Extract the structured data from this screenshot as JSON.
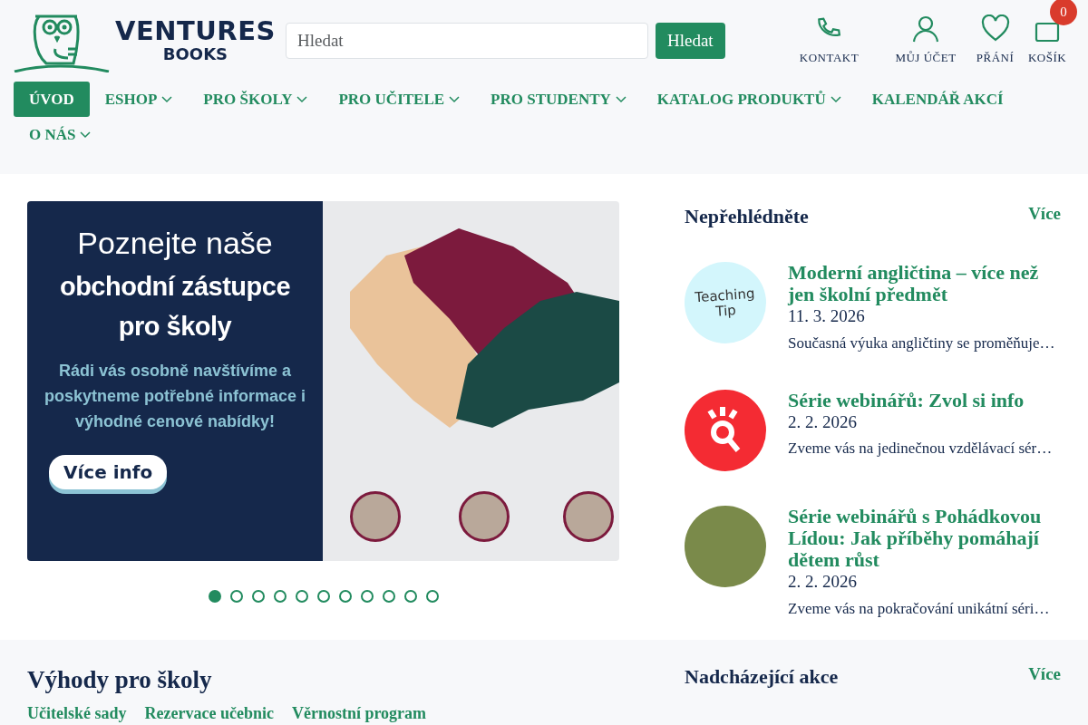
{
  "header": {
    "logo": {
      "line1": "VENTURES",
      "line2": "BOOKS"
    },
    "search": {
      "placeholder": "Hledat",
      "button": "Hledat"
    },
    "actions": [
      {
        "kind": "phone",
        "label": "KONTAKT"
      },
      {
        "kind": "user",
        "label": "MŮJ ÚČET"
      },
      {
        "kind": "heart",
        "label": "PŘÁNÍ"
      },
      {
        "kind": "cart",
        "label": "KOŠÍK",
        "badge": "0"
      }
    ]
  },
  "nav": [
    {
      "label": "ÚVOD",
      "selected": true,
      "dropdown": false
    },
    {
      "label": "ESHOP",
      "selected": false,
      "dropdown": true
    },
    {
      "label": "PRO ŠKOLY",
      "selected": false,
      "dropdown": true
    },
    {
      "label": "PRO UČITELE",
      "selected": false,
      "dropdown": true
    },
    {
      "label": "PRO STUDENTY",
      "selected": false,
      "dropdown": true
    },
    {
      "label": "KATALOG PRODUKTŮ",
      "selected": false,
      "dropdown": true
    },
    {
      "label": "KALENDÁŘ AKCÍ",
      "selected": false,
      "dropdown": false
    },
    {
      "label": "O NÁS",
      "selected": false,
      "dropdown": true
    }
  ],
  "banner": {
    "heading_light": "Poznejte naše",
    "heading_bold": "obchodní zástupce pro školy",
    "text": "Rádi vás osobně navštívíme a poskytneme potřebné informace i **výhodné cenové nabídky!**",
    "button": "Více info"
  },
  "carousel_dots": [
    {
      "selected": true
    },
    {
      "selected": false
    },
    {
      "selected": false
    },
    {
      "selected": false
    },
    {
      "selected": false
    },
    {
      "selected": false
    },
    {
      "selected": false
    },
    {
      "selected": false
    },
    {
      "selected": false
    },
    {
      "selected": false
    },
    {
      "selected": false
    }
  ],
  "highlights": {
    "title": "Nepřehlédněte",
    "more": "Více",
    "items": [
      {
        "kind": "teaching-tip",
        "thumb_text": "Teaching Tip",
        "title": "Moderní angličtina – více než jen školní předmět",
        "date": "11. 3. 2026",
        "excerpt": "Současná výuka angličtiny se proměňuje…"
      },
      {
        "kind": "magnifier",
        "title": "Série webinářů: Zvol si info",
        "date": "2. 2. 2026",
        "excerpt": "Zveme vás na jedinečnou vzdělávací sér…"
      },
      {
        "kind": "photo",
        "title": "Série webinářů s Pohádkovou Lídou: Jak příběhy pomáhají dětem růst",
        "date": "2. 2. 2026",
        "excerpt": "Zveme vás na pokračování unikátní séri…"
      }
    ]
  },
  "benefits": {
    "title": "Výhody pro školy",
    "tabs": [
      "Učitelské sady",
      "Rezervace učebnic",
      "Věrnostní program"
    ]
  },
  "events": {
    "title": "Nadcházející akce",
    "more": "Více"
  }
}
